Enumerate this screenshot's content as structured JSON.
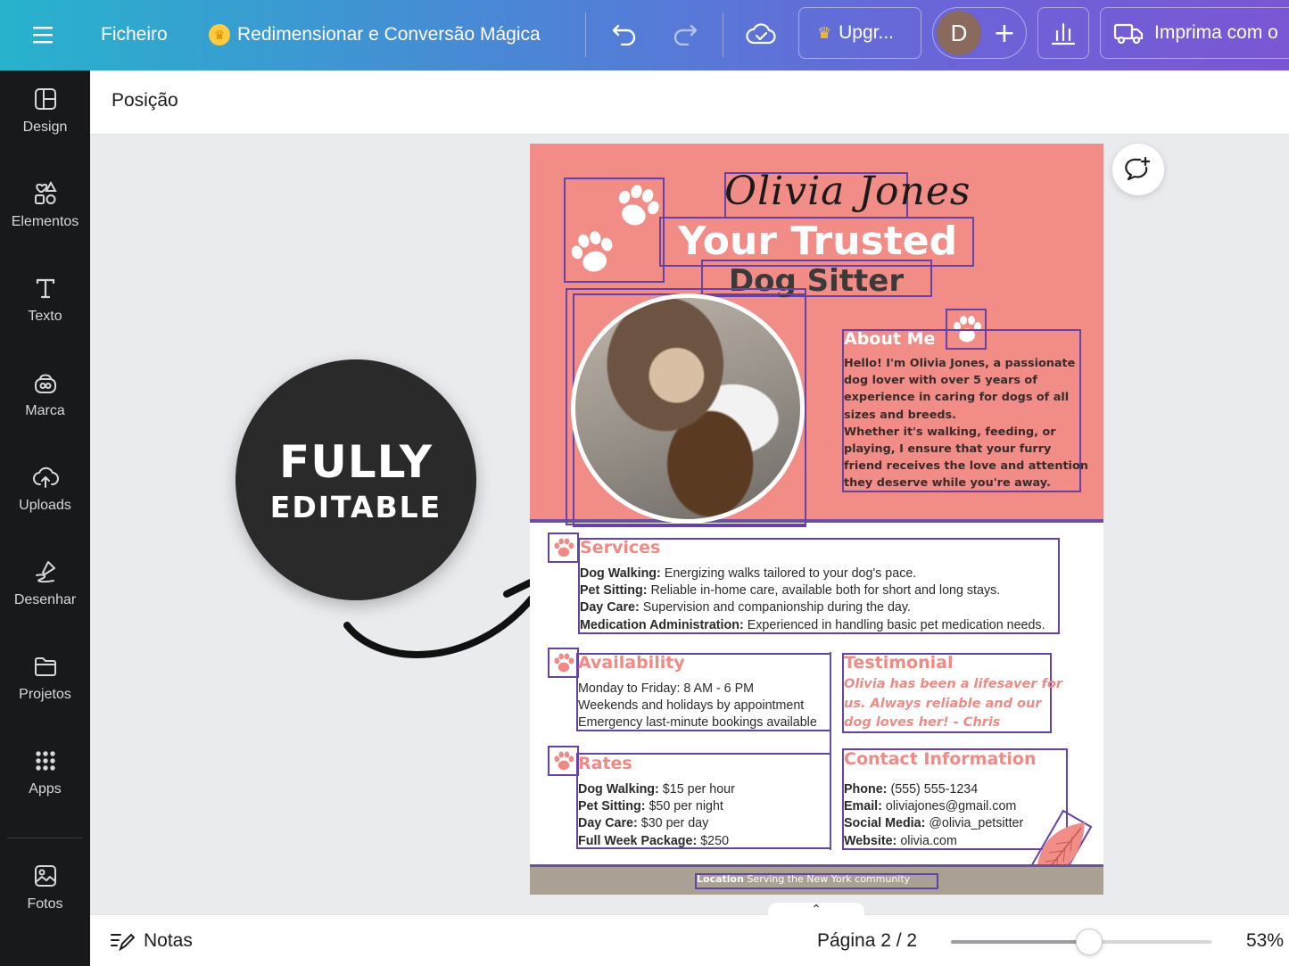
{
  "topbar": {
    "file_label": "Ficheiro",
    "resize_label": "Redimensionar e Conversão Mágica",
    "upgrade_label": "Upgr...",
    "avatar_initial": "D",
    "print_label": "Imprima com o",
    "gradient_start": "#27b3cc",
    "gradient_end": "#7b56d4"
  },
  "sidebar": {
    "items": [
      {
        "label": "Design",
        "icon": "layout-icon"
      },
      {
        "label": "Elementos",
        "icon": "shapes-icon"
      },
      {
        "label": "Texto",
        "icon": "text-icon"
      },
      {
        "label": "Marca",
        "icon": "brand-icon"
      },
      {
        "label": "Uploads",
        "icon": "cloud-upload-icon"
      },
      {
        "label": "Desenhar",
        "icon": "draw-icon"
      },
      {
        "label": "Projetos",
        "icon": "folder-icon"
      },
      {
        "label": "Apps",
        "icon": "grid-icon"
      },
      {
        "label": "Fotos",
        "icon": "image-icon"
      }
    ]
  },
  "context_toolbar": {
    "position_label": "Posição"
  },
  "badge": {
    "line1": "FULLY",
    "line2": "EDITABLE"
  },
  "document": {
    "accent_color": "#f18c86",
    "selection_color": "#6542a8",
    "name": "Olivia Jones",
    "title_line1": "Your Trusted",
    "title_line2": "Dog Sitter",
    "about": {
      "title": "About Me",
      "lines": [
        "Hello! I'm Olivia Jones, a passionate",
        "dog lover with over 5 years of",
        "experience in caring for dogs of all",
        "sizes and breeds.",
        "Whether it's walking, feeding, or",
        "playing, I ensure that your furry",
        "friend receives the love and attention",
        "they deserve while you're away."
      ]
    },
    "services": {
      "title": "Services",
      "items": [
        {
          "label": "Dog Walking:",
          "text": "Energizing walks tailored to your dog's pace."
        },
        {
          "label": "Pet Sitting:",
          "text": "Reliable in-home care, available both for short and long stays."
        },
        {
          "label": "Day Care:",
          "text": "Supervision and companionship during the day."
        },
        {
          "label": "Medication Administration:",
          "text": "Experienced in handling basic pet medication needs."
        }
      ]
    },
    "availability": {
      "title": "Availability",
      "lines": [
        "Monday to Friday: 8 AM - 6 PM",
        "Weekends and holidays by appointment",
        "Emergency last-minute bookings available"
      ]
    },
    "testimonial": {
      "title": "Testimonial",
      "lines": [
        "Olivia has been a lifesaver for",
        "us. Always reliable and our",
        "dog loves her! - Chris"
      ]
    },
    "rates": {
      "title": "Rates",
      "items": [
        {
          "label": "Dog Walking:",
          "text": "$15 per hour"
        },
        {
          "label": "Pet Sitting:",
          "text": "$50 per night"
        },
        {
          "label": "Day Care:",
          "text": "$30 per day"
        },
        {
          "label": "Full Week Package:",
          "text": "$250"
        }
      ]
    },
    "contact": {
      "title": "Contact Information",
      "items": [
        {
          "label": "Phone:",
          "text": "(555) 555-1234"
        },
        {
          "label": "Email:",
          "text": "oliviajones@gmail.com"
        },
        {
          "label": "Social Media:",
          "text": "@olivia_petsitter"
        },
        {
          "label": "Website:",
          "text": "olivia.com"
        }
      ]
    },
    "footer": {
      "label": "Location",
      "text": "Serving the New York community"
    }
  },
  "bottombar": {
    "notes_label": "Notas",
    "page_indicator": "Página 2 / 2",
    "zoom_label": "53%",
    "zoom_fraction": 0.53
  }
}
